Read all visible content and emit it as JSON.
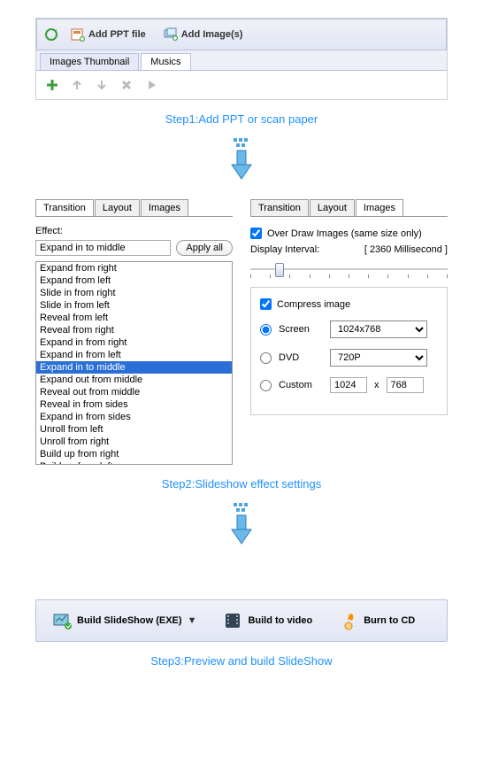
{
  "top": {
    "addPPT": "Add PPT file",
    "addImages": "Add Image(s)",
    "tabs": [
      "Images Thumbnail",
      "Musics"
    ],
    "activeTab": 1
  },
  "step1": "Step1:Add PPT or scan paper",
  "left": {
    "tabs": [
      "Transition",
      "Layout",
      "Images"
    ],
    "activeTab": 0,
    "effectLabel": "Effect:",
    "effectValue": "Expand in to middle",
    "applyAll": "Apply all",
    "effects": [
      "Expand from right",
      "Expand from left",
      "Slide in from right",
      "Slide in from left",
      "Reveal from left",
      "Reveal from right",
      "Expand in from right",
      "Expand in from left",
      "Expand in to middle",
      "Expand out from middle",
      "Reveal out from middle",
      "Reveal in from sides",
      "Expand in from sides",
      "Unroll from left",
      "Unroll from right",
      "Build up from right",
      "Build up from left"
    ],
    "selectedIndex": 8
  },
  "right": {
    "tabs": [
      "Transition",
      "Layout",
      "Images"
    ],
    "activeTab": 2,
    "overDraw": "Over Draw Images (same size only)",
    "displayIntervalLabel": "Display Interval:",
    "displayIntervalValue": "[ 2360 Millisecond ]",
    "compress": "Compress image",
    "screen": {
      "label": "Screen",
      "value": "1024x768"
    },
    "dvd": {
      "label": "DVD",
      "value": "720P"
    },
    "custom": {
      "label": "Custom",
      "w": "1024",
      "x": "x",
      "h": "768"
    },
    "radioSelected": "screen"
  },
  "step2": "Step2:Slideshow effect settings",
  "build": {
    "buildSlideshow": "Build SlideShow (EXE)",
    "buildVideo": "Build to video",
    "burnCD": "Burn to CD"
  },
  "step3": "Step3:Preview and build SlideShow"
}
